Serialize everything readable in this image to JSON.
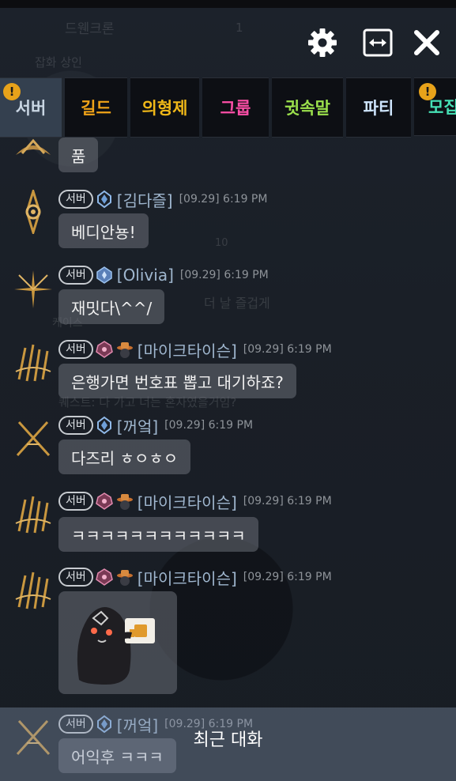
{
  "background": {
    "ghost_texts": [
      "드웬크론",
      "잡화 상인",
      "더 날 즐겁게",
      "케이스",
      "퀘스트: 다 가고 너는 혼자였을거임?",
      "10",
      "1"
    ]
  },
  "header": {
    "settings_icon": "gear-icon",
    "resize_icon": "resize-horizontal-icon",
    "close_icon": "close-icon"
  },
  "tabs": [
    {
      "label": "서버",
      "color": "#c9d6e3",
      "active": true,
      "alert": "!"
    },
    {
      "label": "길드",
      "color": "#f0a318"
    },
    {
      "label": "의형제",
      "color": "#f0b818"
    },
    {
      "label": "그룹",
      "color": "#ff4fa8"
    },
    {
      "label": "귓속말",
      "color": "#9be04c"
    },
    {
      "label": "파티",
      "color": "#cfe6ff"
    },
    {
      "label": "모집",
      "color": "#46e0b5",
      "alert": "!"
    }
  ],
  "messages": [
    {
      "text": "품"
    },
    {
      "channel": "서버",
      "name": "[김다즐]",
      "time": "[09.29] 6:19 PM",
      "text": "베디안뇽!"
    },
    {
      "channel": "서버",
      "name": "[Olivia]",
      "time": "[09.29] 6:19 PM",
      "text": "재밋다\\^^/"
    },
    {
      "channel": "서버",
      "name": "[마이크타이슨]",
      "time": "[09.29] 6:19 PM",
      "text": "은행가면 번호표 뽑고 대기하죠?"
    },
    {
      "channel": "서버",
      "name": "[꺼엌]",
      "time": "[09.29] 6:19 PM",
      "text": "다즈리 ㅎㅇㅎㅇ"
    },
    {
      "channel": "서버",
      "name": "[마이크타이슨]",
      "time": "[09.29] 6:19 PM",
      "text": "ㅋㅋㅋㅋㅋㅋㅋㅋㅋㅋㅋㅋ"
    },
    {
      "channel": "서버",
      "name": "[마이크타이슨]",
      "time": "[09.29] 6:19 PM",
      "sticker": "ghost-thumbs-up-sticker"
    },
    {
      "channel": "서버",
      "name": "[꺼엌]",
      "time": "[09.29] 6:19 PM",
      "text": "어익후 ㅋㅋㅋ"
    }
  ],
  "recent_chat_label": "최근 대화",
  "colors": {
    "name": "#9fb6ce",
    "time": "#8e9399",
    "alert": "#e7a21a"
  }
}
